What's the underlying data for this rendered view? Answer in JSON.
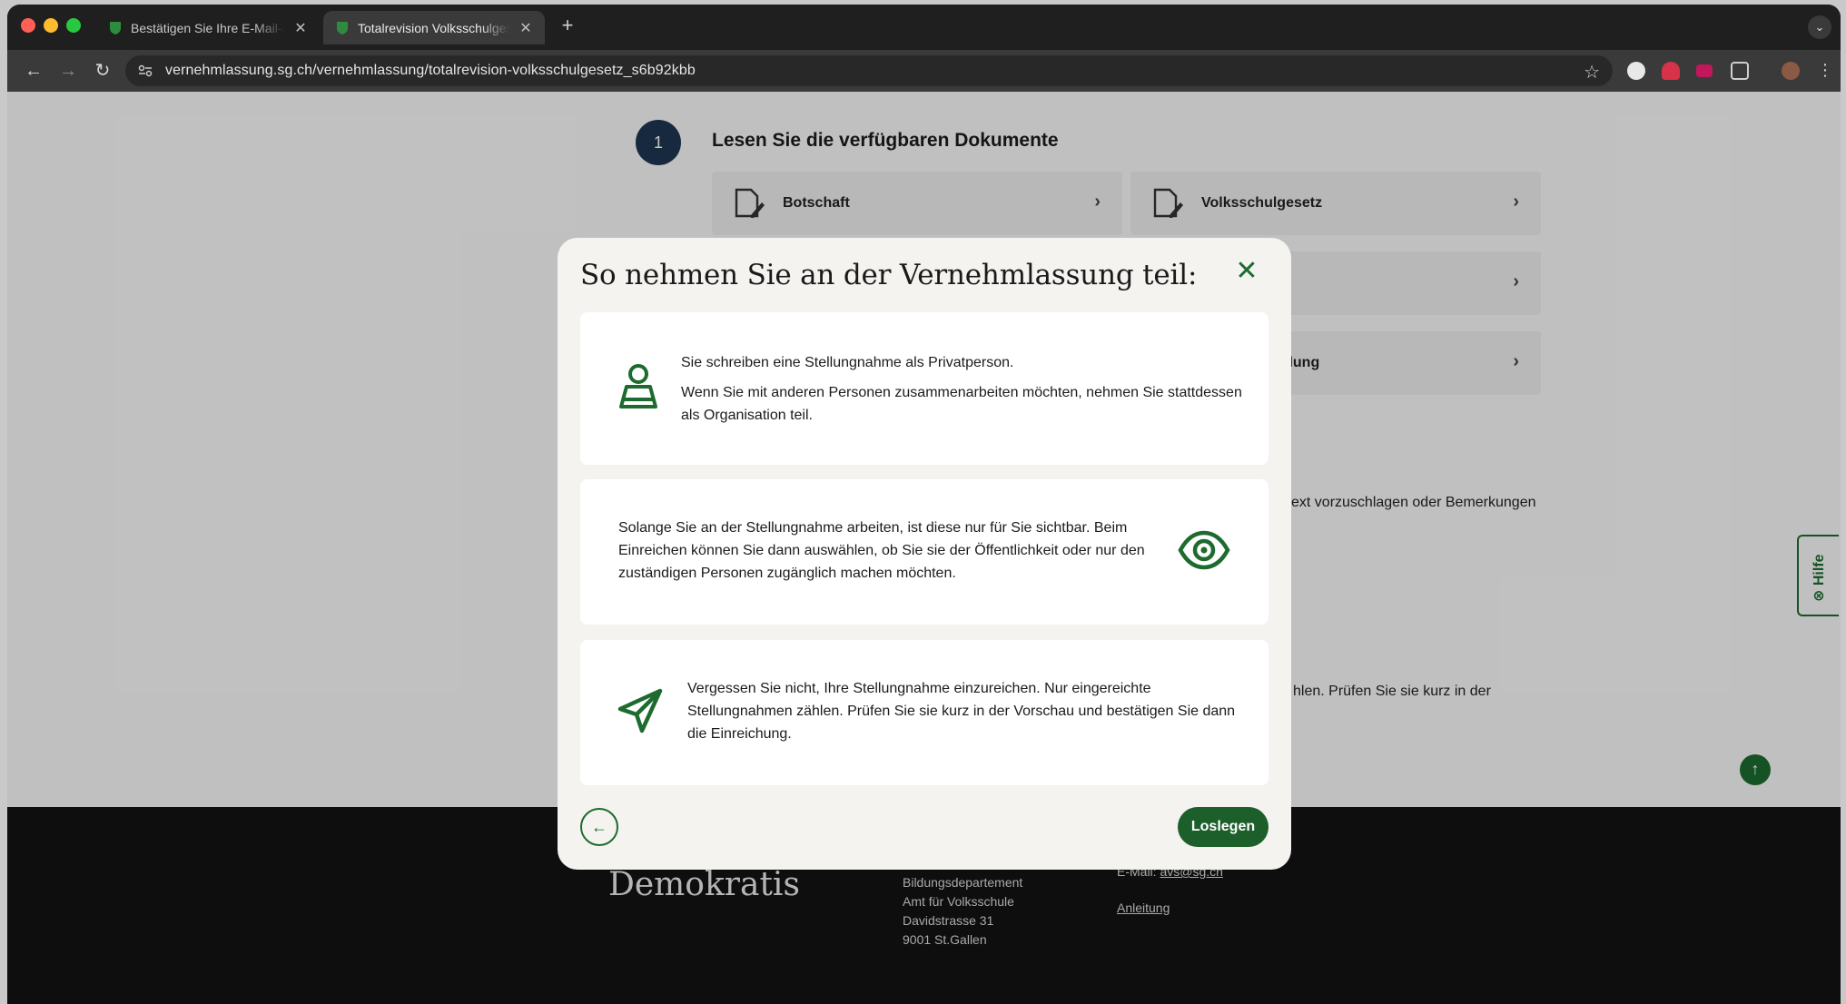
{
  "browser": {
    "tabs": [
      {
        "title": "Bestätigen Sie Ihre E-Mail-Adresse",
        "close": "✕"
      },
      {
        "title": "Totalrevision Volksschulgesetz",
        "close": "✕"
      }
    ],
    "new_tab": "+",
    "tab_menu": "⌄",
    "url": "vernehmlassung.sg.ch/vernehmlassung/totalrevision-volksschulgesetz_s6b92kbb",
    "nav": {
      "back": "←",
      "forward": "→",
      "reload": "↻"
    },
    "bookmark": "☆"
  },
  "page": {
    "step_number": "1",
    "step_title": "Lesen Sie die verfügbaren Dokumente",
    "documents": [
      {
        "label": "Botschaft",
        "chevron": "›"
      },
      {
        "label": "Volksschulgesetz",
        "chevron": "›"
      },
      {
        "label": "",
        "chevron": "›"
      },
      {
        "label": "llung",
        "chevron": "›"
      }
    ],
    "bg_text_1": "ext vorzuschlagen oder Bemerkungen",
    "bg_text_2": "hlen. Prüfen Sie sie kurz in der",
    "help_label": "⊗ Hilfe",
    "scroll_top": "↑"
  },
  "footer": {
    "brand": "Demokratis",
    "address": [
      "Bildungsdepartement",
      "Amt für Volksschule",
      "Davidstrasse 31",
      "9001 St.Gallen"
    ],
    "email_label": "E-Mail:",
    "email": "avs@sg.ch",
    "guide": "Anleitung"
  },
  "modal": {
    "title": "So nehmen Sie an der Vernehmlassung teil:",
    "close": "✕",
    "cards": [
      {
        "icon": "person-icon",
        "line1": "Sie schreiben eine Stellungnahme als Privatperson.",
        "line2": "Wenn Sie mit anderen Personen zusammenarbeiten möchten, nehmen Sie stattdessen als Organisation teil."
      },
      {
        "icon": "eye-icon",
        "text": "Solange Sie an der Stellungnahme arbeiten, ist diese nur für Sie sichtbar. Beim Einreichen können Sie dann auswählen, ob Sie sie der Öffentlichkeit oder nur den zuständigen Personen zugänglich machen möchten."
      },
      {
        "icon": "paper-plane-icon",
        "text": "Vergessen Sie nicht, Ihre Stellungnahme einzureichen. Nur eingereichte Stellungnahmen zählen. Prüfen Sie sie kurz in der Vorschau und bestätigen Sie dann die Einreichung."
      }
    ],
    "back_button": "←",
    "start_button": "Loslegen"
  },
  "colors": {
    "accent": "#1d6b2f",
    "step_circle": "#1e3550",
    "footer": "#121212"
  }
}
